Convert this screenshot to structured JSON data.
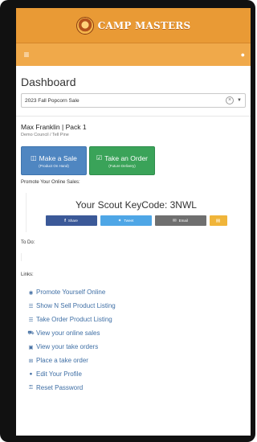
{
  "app": {
    "brand": "CAMP MASTERS"
  },
  "colors": {
    "brand_orange": "#e99a35",
    "nav_orange": "#f0a94a",
    "sale_blue": "#4f86c1",
    "order_green": "#3aa359",
    "facebook": "#3b5998",
    "twitter": "#4ea6e6",
    "email": "#6f6f6f",
    "sms": "#f0b53a",
    "link_blue": "#3f6fa5"
  },
  "nav": {
    "menu_icon": "hamburger-icon",
    "user_icon": "user-icon"
  },
  "page": {
    "title": "Dashboard"
  },
  "sale_select": {
    "value": "2023 Fall Popcorn Sale"
  },
  "scout": {
    "name": "Max Franklin | Pack 1",
    "subtitle": "Demo Council / Tell Pine"
  },
  "actions": {
    "make_sale": {
      "label": "Make a Sale",
      "sub": "(Product On Hand)",
      "icon": "basket-icon"
    },
    "take_order": {
      "label": "Take an Order",
      "sub": "(Future Delivery)",
      "icon": "checkbox-icon"
    }
  },
  "promote": {
    "label": "Promote Your Online Sales:",
    "keycode_text": "Your Scout KeyCode: 3NWL",
    "share": {
      "facebook": "Share",
      "twitter": "Tweet",
      "email": "Email"
    }
  },
  "todo": {
    "label": "To Do:"
  },
  "links": {
    "label": "Links:",
    "items": [
      {
        "label": "Promote Yourself Online",
        "icon": "globe-icon"
      },
      {
        "label": "Show N Sell Product Listing",
        "icon": "list-icon"
      },
      {
        "label": "Take Order Product Listing",
        "icon": "list-icon"
      },
      {
        "label": "View your online sales",
        "icon": "cart-icon"
      },
      {
        "label": "View your take orders",
        "icon": "bag-icon"
      },
      {
        "label": "Place a take order",
        "icon": "plus-square-icon"
      },
      {
        "label": "Edit Your Profile",
        "icon": "user-icon"
      },
      {
        "label": "Reset Password",
        "icon": "key-icon"
      }
    ]
  }
}
